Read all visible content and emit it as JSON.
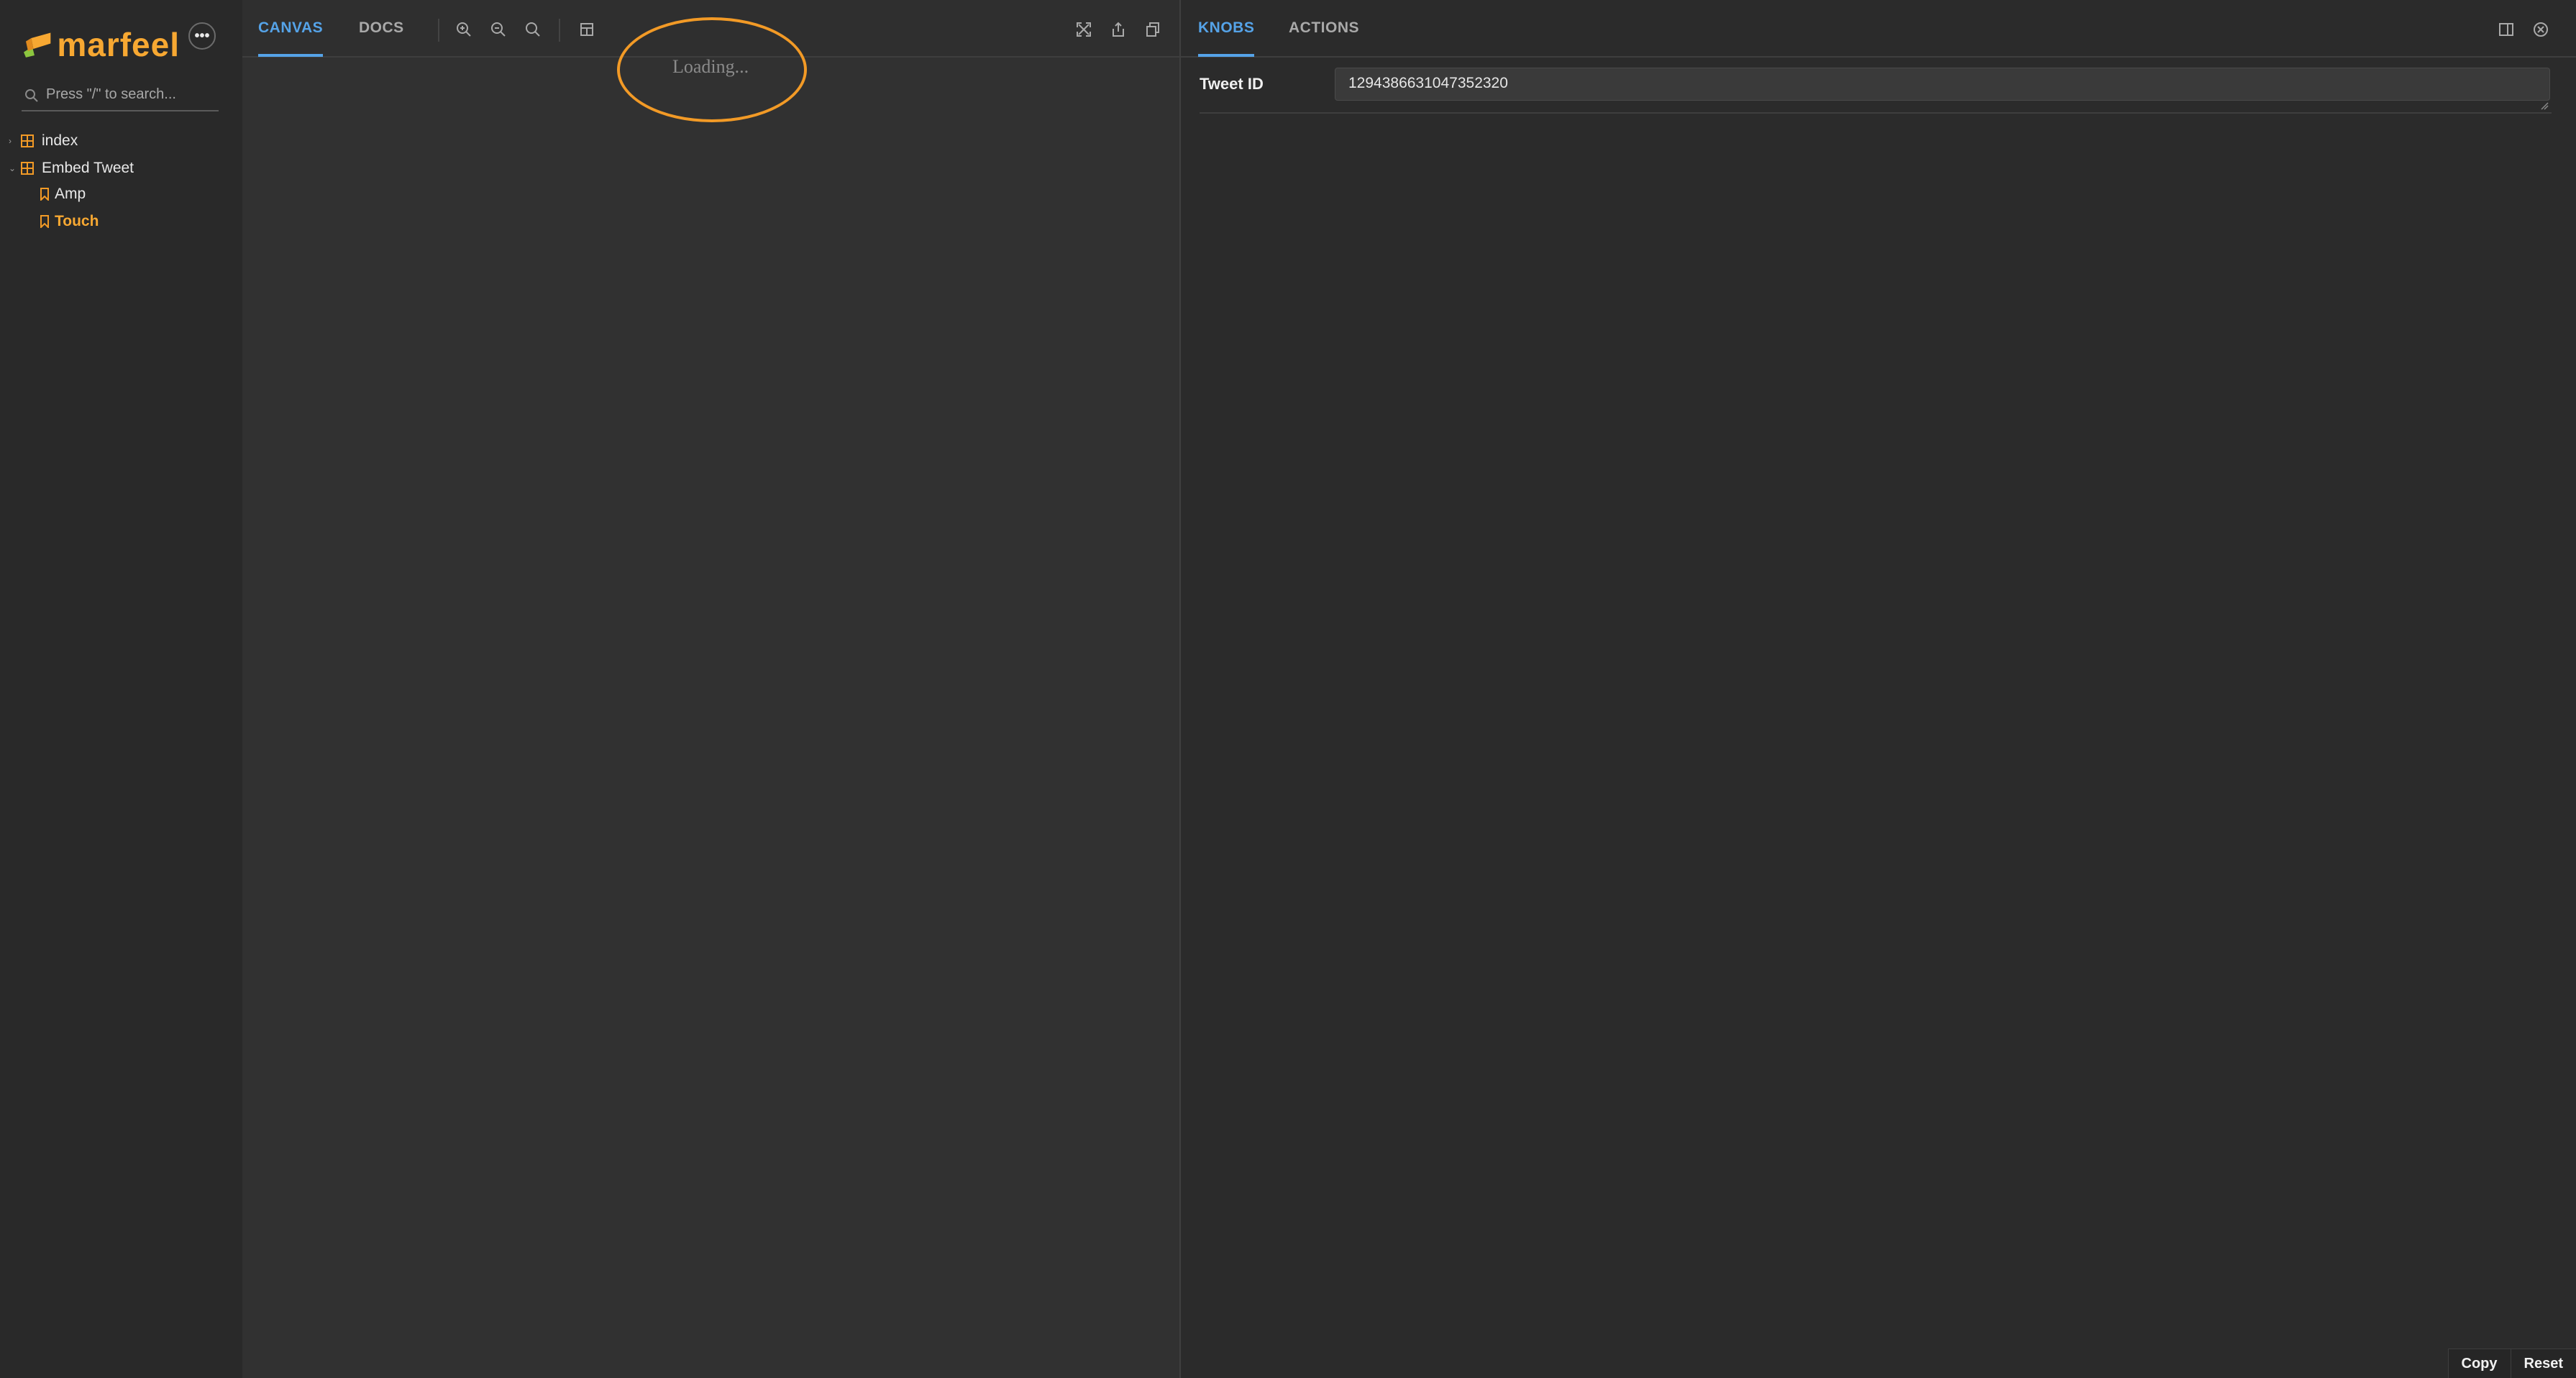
{
  "sidebar": {
    "brand": "marfeel",
    "more_label": "•••",
    "search_placeholder": "Press \"/\" to search...",
    "tree": [
      {
        "label": "index"
      },
      {
        "label": "Embed Tweet"
      },
      {
        "label": "Amp"
      },
      {
        "label": "Touch"
      }
    ]
  },
  "toolbar": {
    "tabs": [
      "CANVAS",
      "DOCS"
    ],
    "active_tab": "CANVAS"
  },
  "canvas": {
    "loading_text": "Loading..."
  },
  "addons": {
    "tabs": [
      "KNOBS",
      "ACTIONS"
    ],
    "active_tab": "KNOBS",
    "knobs": [
      {
        "label": "Tweet ID",
        "value": "1294386631047352320"
      }
    ],
    "buttons": {
      "copy": "Copy",
      "reset": "Reset"
    }
  },
  "colors": {
    "accent": "#55a3e8",
    "brand": "#f7a832",
    "annotation": "#f29a26"
  }
}
